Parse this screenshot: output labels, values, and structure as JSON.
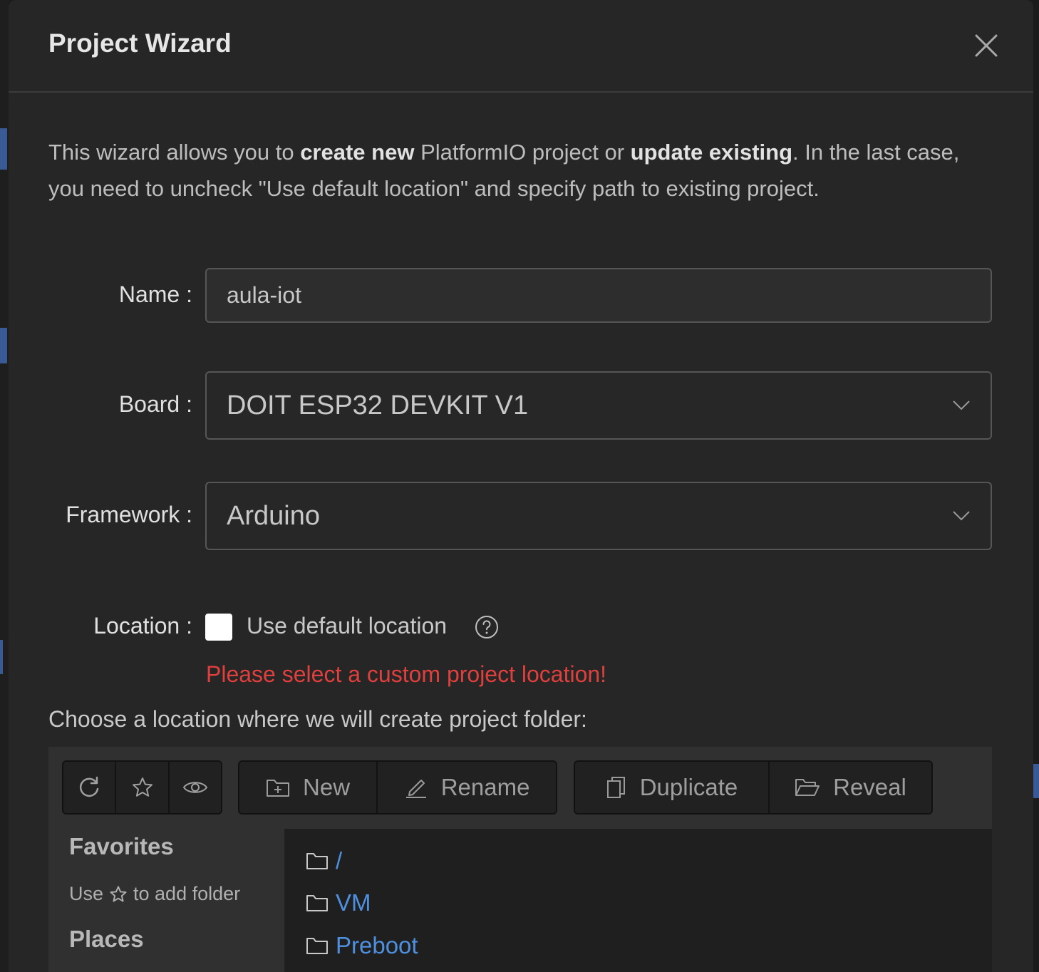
{
  "dialog": {
    "title": "Project Wizard",
    "intro_pre": "This wizard allows you to ",
    "intro_bold1": "create new",
    "intro_mid": " PlatformIO project or ",
    "intro_bold2": "update existing",
    "intro_post": ". In the last case, you need to uncheck \"Use default location\" and specify path to existing project."
  },
  "form": {
    "name_label": "Name",
    "name_value": "aula-iot",
    "board_label": "Board",
    "board_value": "DOIT ESP32 DEVKIT V1",
    "framework_label": "Framework",
    "framework_value": "Arduino",
    "location_label": "Location",
    "use_default_label": "Use default location",
    "use_default_checked": false,
    "error": "Please select a custom project location!",
    "choose_label": "Choose a location where we will create project folder:"
  },
  "toolbar": {
    "new_label": "New",
    "rename_label": "Rename",
    "duplicate_label": "Duplicate",
    "reveal_label": "Reveal"
  },
  "sidebar": {
    "favorites_heading": "Favorites",
    "favorites_hint_pre": "Use",
    "favorites_hint_post": "to add folder",
    "places_heading": "Places"
  },
  "files": [
    {
      "name": "/"
    },
    {
      "name": "VM"
    },
    {
      "name": "Preboot"
    }
  ],
  "colors": {
    "link": "#4f8fdf",
    "error": "#e0403d"
  }
}
